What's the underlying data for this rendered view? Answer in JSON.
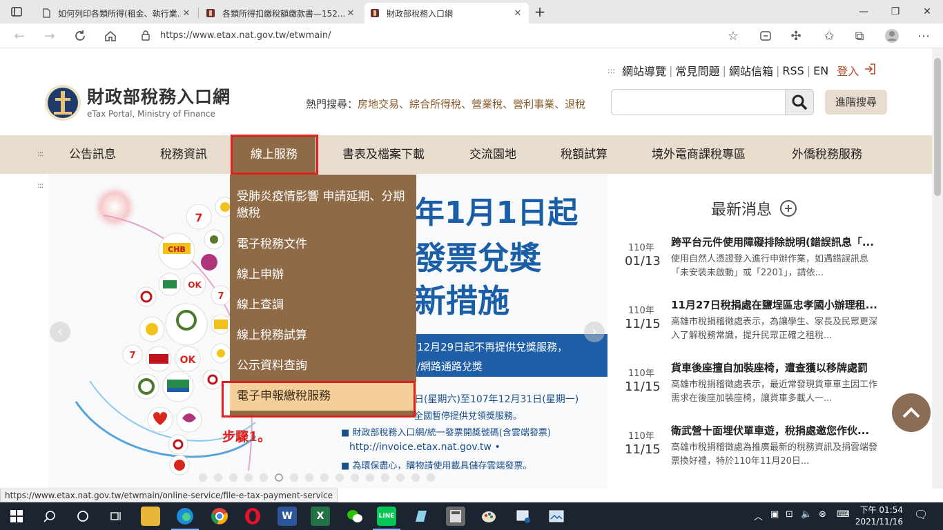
{
  "browser": {
    "tabs": [
      {
        "title": "如何列印各類所得(租金、執行業...",
        "active": false
      },
      {
        "title": "各類所得扣繳稅額繳款書—152...",
        "active": false
      },
      {
        "title": "財政部稅務入口網",
        "active": true
      }
    ],
    "url": "https://www.etax.nat.gov.tw/etwmain/",
    "status_url": "https://www.etax.nat.gov.tw/etwmain/online-service/file-e-tax-payment-service"
  },
  "site": {
    "util_links": [
      "網站導覽",
      "常見問題",
      "網站信箱",
      "RSS",
      "EN"
    ],
    "login": "登入",
    "logo_title": "財政部稅務入口網",
    "logo_subtitle": "eTax Portal, Ministry of Finance",
    "hot_label": "熱門搜尋：",
    "hot_items": [
      "房地交易",
      "綜合所得稅",
      "營業稅",
      "營利事業",
      "退稅"
    ],
    "advanced_search": "進階搜尋"
  },
  "nav": [
    "公告訊息",
    "稅務資訊",
    "線上服務",
    "書表及檔案下載",
    "交流園地",
    "稅額試算",
    "境外電商課稅專區",
    "外僑稅務服務"
  ],
  "dropdown": [
    "受肺炎疫情影響 申請延期、分期繳稅",
    "電子稅務文件",
    "線上申辦",
    "線上查調",
    "線上稅務試算",
    "公示資料查詢",
    "電子申報繳稅服務"
  ],
  "step_label": "步驟1。",
  "banner": {
    "line1": "年1月1日起",
    "line2": "發票兌獎",
    "line3": "新措施",
    "strip1": "12月29日起不再提供兌獎服務，",
    "strip2": "/網路通路兌獎",
    "l1": "日(星期六)至107年12月31日(星期一)",
    "l2": "全國暫停提供兌領獎服務。",
    "l3": "■ 財政部稅務入口網/統一發票開獎號碼(含雲端發票)",
    "l4": "http://invoice.etax.nat.gov.tw •",
    "l5": "■ 為環保盡心，購物請使用載具儲存雲端發票。"
  },
  "news": {
    "heading": "最新消息",
    "items": [
      {
        "year": "110年",
        "date": "01/13",
        "title": "跨平台元件使用障礙排除說明(錯誤訊息「...",
        "desc": "使用自然人憑證登入進行申辦作業，如遇錯誤訊息「未安裝未啟動」或「2201」，請依..."
      },
      {
        "year": "110年",
        "date": "11/15",
        "title": "11月27日稅捐處在鹽埕區忠孝國小辦理租...",
        "desc": "高雄市稅捐稽徵處表示，為讓學生、家長及民眾更深入了解稅務常識，提升民眾正確之租稅..."
      },
      {
        "year": "110年",
        "date": "11/15",
        "title": "貨車後座擅自加裝座椅，遭查獲以移牌處罰",
        "desc": "高雄市稅捐稽徵處表示，最近常發現貨車車主因工作需求在後座加裝座椅，讓貨車多載人一..."
      },
      {
        "year": "110年",
        "date": "11/15",
        "title": "衛武營十面埋伏單車遊，稅捐處邀您作伙...",
        "desc": "高雄市稅捐稽徵處為推廣最新的稅務資訊及捐雲端發票換好禮，特於110年11月20日..."
      }
    ]
  },
  "taskbar": {
    "time": "下午 01:54",
    "date": "2021/11/16"
  },
  "colors": {
    "nav_bg": "#e9ddce",
    "nav_active": "#8f6a46",
    "dropdown_highlight": "#f4cf98",
    "annotation_red": "#e0201e"
  }
}
